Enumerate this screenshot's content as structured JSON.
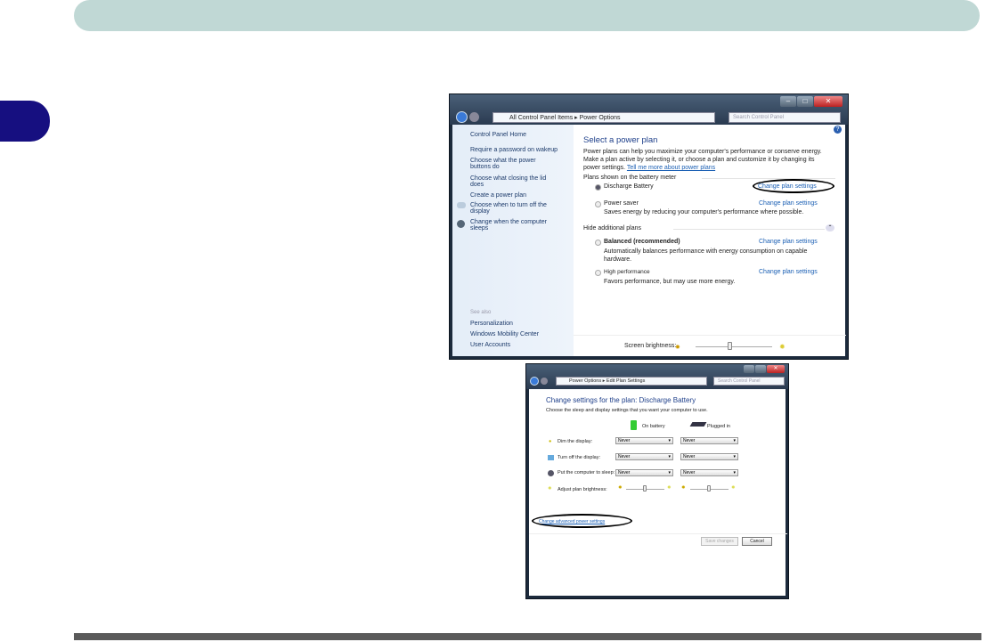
{
  "page": {
    "accent": "#160f80",
    "header_color": "#c0d8d5"
  },
  "win1": {
    "breadcrumb": [
      "All Control Panel Items",
      "Power Options"
    ],
    "search_placeholder": "Search Control Panel",
    "sidebar": {
      "home": "Control Panel Home",
      "items": [
        "Require a password on wakeup",
        "Choose what the power buttons do",
        "Choose what closing the lid does",
        "Create a power plan",
        "Choose when to turn off the display",
        "Change when the computer sleeps"
      ],
      "see_also": "See also",
      "see_also_items": [
        "Personalization",
        "Windows Mobility Center",
        "User Accounts"
      ]
    },
    "title": "Select a power plan",
    "intro": "Power plans can help you maximize your computer's performance or conserve energy. Make a plan active by selecting it, or choose a plan and customize it by changing its power settings.",
    "intro_link": "Tell me more about power plans",
    "section1": "Plans shown on the battery meter",
    "section2": "Hide additional plans",
    "plans": [
      {
        "name": "Discharge Battery",
        "desc": "",
        "link": "Change plan settings",
        "selected": true
      },
      {
        "name": "Power saver",
        "desc": "Saves energy by reducing your computer's performance where possible.",
        "link": "Change plan settings",
        "selected": false
      },
      {
        "name": "Balanced (recommended)",
        "desc": "Automatically balances performance with energy consumption on capable hardware.",
        "link": "Change plan settings",
        "selected": false
      },
      {
        "name": "High performance",
        "desc": "Favors performance, but may use more energy.",
        "link": "Change plan settings",
        "selected": false
      }
    ],
    "brightness_label": "Screen brightness:",
    "brightness": 0.45
  },
  "win2": {
    "breadcrumb": [
      "Power Options",
      "Edit Plan Settings"
    ],
    "search_placeholder": "Search Control Panel",
    "title": "Change settings for the plan: Discharge Battery",
    "subtitle": "Choose the sleep and display settings that you want your computer to use.",
    "col_battery": "On battery",
    "col_plugged": "Plugged in",
    "rows": [
      {
        "label": "Dim the display:",
        "battery": "Never",
        "plugged": "Never"
      },
      {
        "label": "Turn off the display:",
        "battery": "Never",
        "plugged": "Never"
      },
      {
        "label": "Put the computer to sleep:",
        "battery": "Never",
        "plugged": "Never"
      }
    ],
    "brightness_label": "Adjust plan brightness:",
    "brightness_battery": 0.45,
    "brightness_plugged": 0.45,
    "advanced_link": "Change advanced power settings",
    "save": "Save changes",
    "cancel": "Cancel"
  }
}
